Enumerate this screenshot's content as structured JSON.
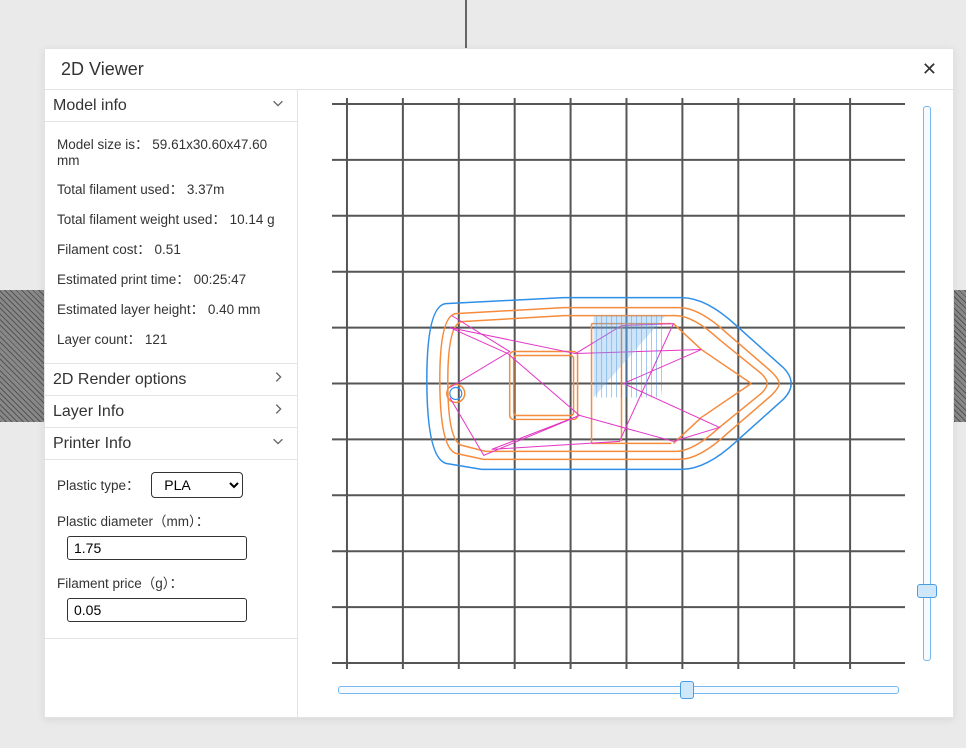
{
  "title": "2D Viewer",
  "sections": {
    "model_info": {
      "header": "Model info",
      "expanded": true,
      "items": {
        "size": {
          "label": "Model size is",
          "value": "59.61x30.60x47.60 mm"
        },
        "fil": {
          "label": "Total filament used",
          "value": "3.37m"
        },
        "wt": {
          "label": "Total filament weight used",
          "value": "10.14 g"
        },
        "cost": {
          "label": "Filament cost",
          "value": "0.51"
        },
        "time": {
          "label": "Estimated print time",
          "value": "00:25:47"
        },
        "layerh": {
          "label": "Estimated layer height",
          "value": "0.40 mm"
        },
        "layers": {
          "label": "Layer count",
          "value": "121"
        }
      }
    },
    "render_opts": {
      "header": "2D Render options",
      "expanded": false
    },
    "layer_info": {
      "header": "Layer Info",
      "expanded": false
    },
    "printer_info": {
      "header": "Printer Info",
      "expanded": true,
      "plastic_type_label": "Plastic type",
      "plastic_type_value": "PLA",
      "plastic_diameter_label": "Plastic diameter（mm）",
      "plastic_diameter_value": "1.75",
      "filament_price_label": "Filament price（g）",
      "filament_price_value": "0.05"
    }
  }
}
